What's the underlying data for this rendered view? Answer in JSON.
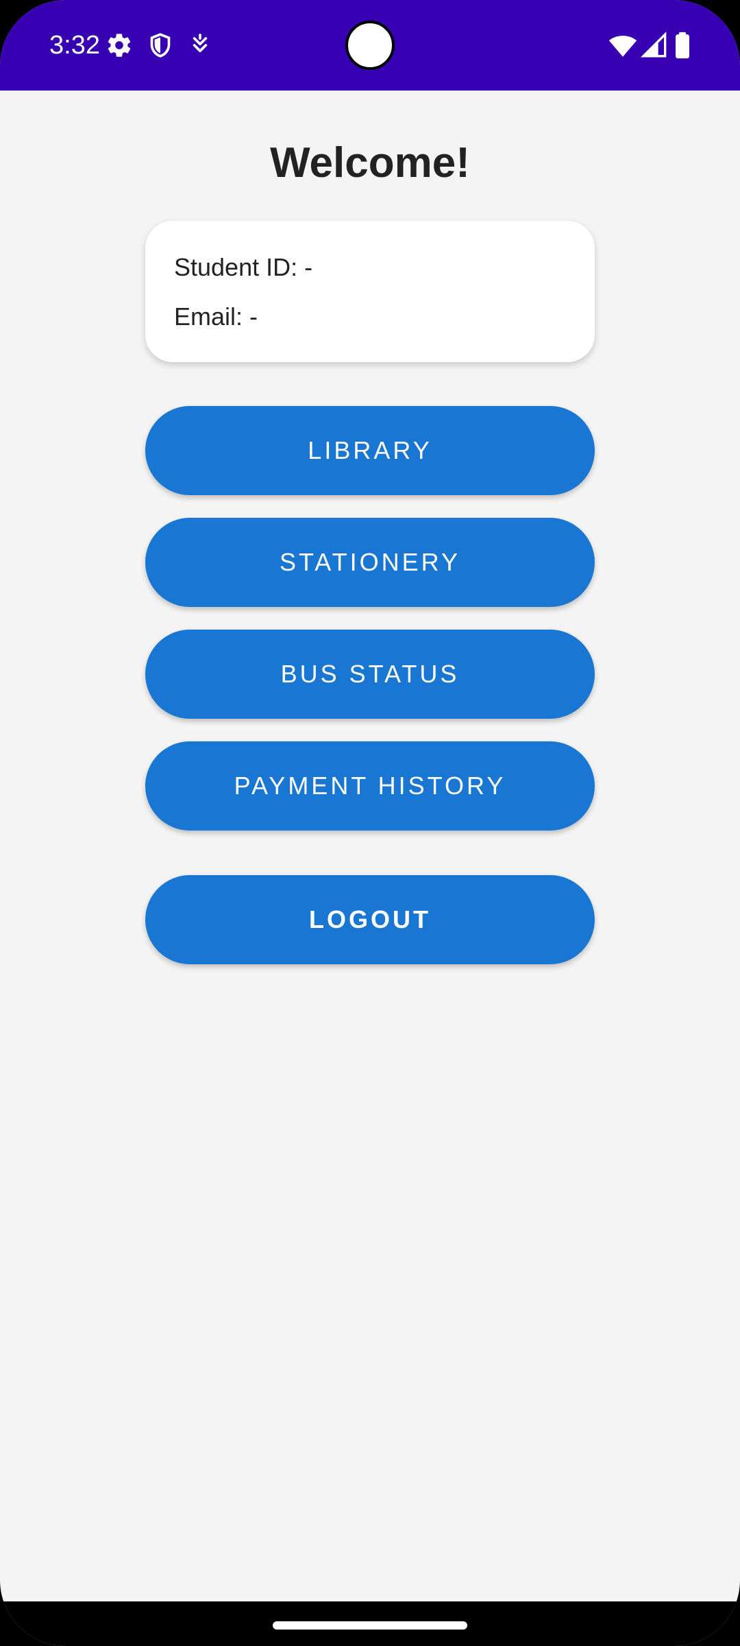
{
  "status_bar": {
    "time": "3:32",
    "left_icons": [
      "gear-icon",
      "shield-icon",
      "download-icon"
    ],
    "right_icons": [
      "wifi-icon",
      "signal-icon",
      "battery-icon"
    ],
    "background_color": "#3700b3"
  },
  "main": {
    "title": "Welcome!",
    "info_card": {
      "student_id": "Student ID: -",
      "email": "Email: -"
    },
    "buttons": [
      {
        "label": "LIBRARY"
      },
      {
        "label": "STATIONERY"
      },
      {
        "label": "BUS STATUS"
      },
      {
        "label": "PAYMENT HISTORY"
      }
    ],
    "logout_label": "LOGOUT"
  },
  "colors": {
    "accent": "#1976d2",
    "background": "#f4f4f4",
    "card": "#ffffff"
  }
}
